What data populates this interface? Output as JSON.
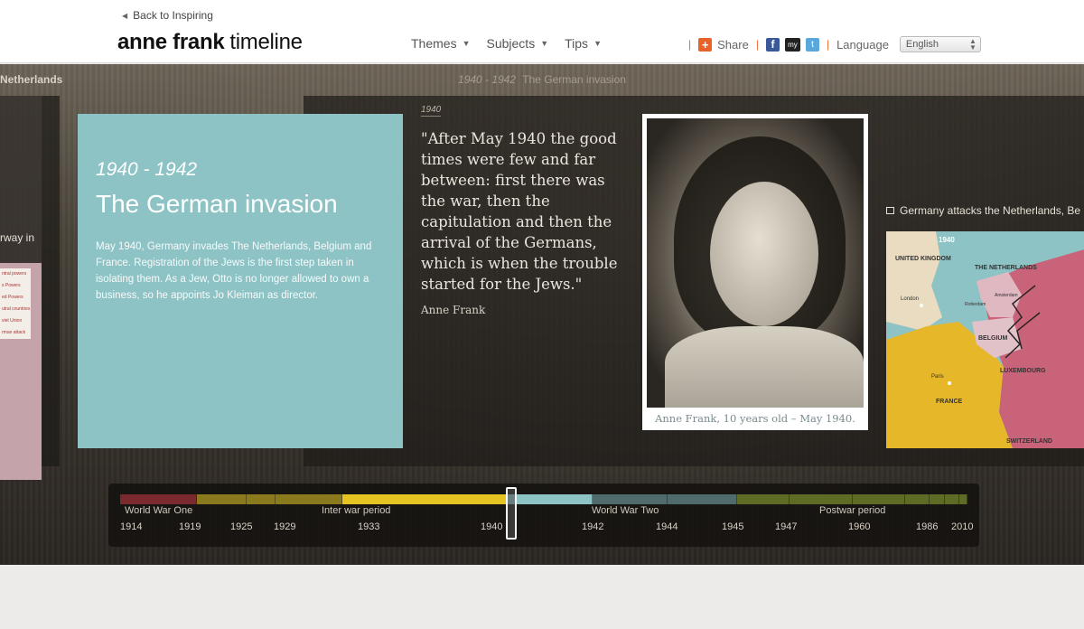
{
  "header": {
    "back_link": "Back to Inspiring",
    "logo_bold": "anne frank",
    "logo_light": "timeline",
    "nav": [
      {
        "label": "Themes"
      },
      {
        "label": "Subjects"
      },
      {
        "label": "Tips"
      }
    ],
    "share_label": "Share",
    "language_label": "Language",
    "language_value": "English",
    "icons": [
      "plus-icon",
      "facebook-icon",
      "myspace-icon",
      "twitter-icon"
    ]
  },
  "stage": {
    "left_edge_label": "Netherlands",
    "title_years": "1940 - 1942",
    "title_text": "The German invasion",
    "left_card_text": "rway in",
    "left_legend": [
      "ntral powers",
      "s Powers",
      "ed Powers",
      "utral countries",
      "viet Union",
      "rman attack"
    ]
  },
  "card": {
    "years": "1940 - 1942",
    "title": "The German invasion",
    "description": "May 1940, Germany invades The Netherlands, Belgium and France. Registration of the Jews is the first step taken in isolating them. As a Jew, Otto is no longer allowed to own a business, so he appoints Jo Kleiman as director."
  },
  "quote": {
    "year": "1940",
    "text": "\"After May 1940 the good times were few and far between: first there was the war, then the capitulation and then the arrival of the Germans, which is when the trouble started for the Jews.\"",
    "author": "Anne Frank"
  },
  "photo": {
    "caption": "Anne Frank, 10 years old – May 1940."
  },
  "map_card": {
    "heading": "Germany attacks the Netherlands, Be",
    "year": "1940",
    "labels": [
      "UNITED KINGDOM",
      "THE NETHERLANDS",
      "London",
      "BELGIUM",
      "LUXEMBOURG",
      "Paris",
      "FRANCE",
      "SWITZERLAND",
      "Amsterdam",
      "Rotterdam"
    ]
  },
  "timeline": {
    "periods": [
      "World War One",
      "Inter war period",
      "World War Two",
      "Postwar period"
    ],
    "years": [
      "1914",
      "1919",
      "1925",
      "1929",
      "1933",
      "1940",
      "1942",
      "1944",
      "1945",
      "1947",
      "1960",
      "1986",
      "2010"
    ],
    "colors": {
      "ww1": "#7a2a2e",
      "interwar_dark": "#8b7a1d",
      "interwar_bright": "#e5c320",
      "current": "#8ec3c5",
      "ww2": "#4f6b6b",
      "postwar": "#5d6b24"
    }
  }
}
